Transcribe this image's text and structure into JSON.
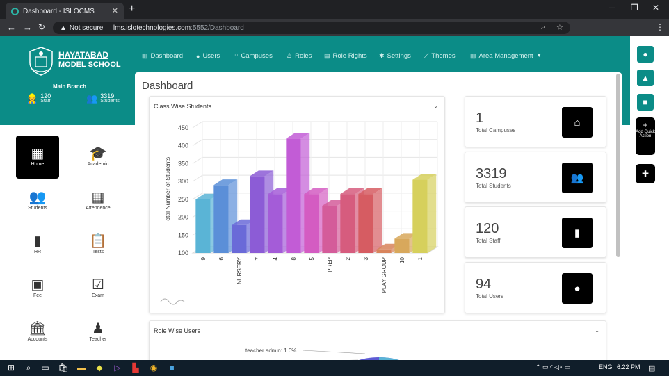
{
  "browser": {
    "tab_title": "Dashboard - ISLOCMS",
    "not_secure": "Not secure",
    "url_host": "lms.islotechnologies.com",
    "url_rest": ":5552/Dashboard"
  },
  "school": {
    "line1": "HAYATABAD",
    "line2": "MODEL SCHOOL"
  },
  "branch": "Main Branch",
  "header_stats": [
    {
      "value": "120",
      "label": "Staff"
    },
    {
      "value": "3319",
      "label": "Students"
    }
  ],
  "menu": [
    {
      "label": "Dashboard",
      "icon": "chart-icon"
    },
    {
      "label": "Users",
      "icon": "user-icon"
    },
    {
      "label": "Campuses",
      "icon": "sitemap-icon"
    },
    {
      "label": "Roles",
      "icon": "roles-icon"
    },
    {
      "label": "Role Rights",
      "icon": "list-icon"
    },
    {
      "label": "Settings",
      "icon": "gear-icon"
    },
    {
      "label": "Themes",
      "icon": "brush-icon"
    },
    {
      "label": "Area Management",
      "icon": "chart-icon"
    }
  ],
  "sidebar": [
    {
      "label": "Home",
      "icon": "home-grid-icon"
    },
    {
      "label": "Academic",
      "icon": "graduation-cap-icon"
    },
    {
      "label": "Students",
      "icon": "users-icon"
    },
    {
      "label": "Attendence",
      "icon": "calendar-icon"
    },
    {
      "label": "HR",
      "icon": "id-badge-icon"
    },
    {
      "label": "Tests",
      "icon": "clipboard-icon"
    },
    {
      "label": "Fee",
      "icon": "money-icon"
    },
    {
      "label": "Exam",
      "icon": "clipboard-check-icon"
    },
    {
      "label": "Accounts",
      "icon": "bank-icon"
    },
    {
      "label": "Teacher",
      "icon": "teacher-icon"
    }
  ],
  "page_title": "Dashboard",
  "chart_card_title": "Class Wise Students",
  "role_card_title": "Role Wise Users",
  "role_pie_label": "teacher admin: 1.0%",
  "quick_action": "Add Quick Action",
  "stat_cards": [
    {
      "value": "1",
      "label": "Total Campuses",
      "icon": "home-icon"
    },
    {
      "value": "3319",
      "label": "Total Students",
      "icon": "users-icon"
    },
    {
      "value": "120",
      "label": "Total Staff",
      "icon": "id-badge-icon"
    },
    {
      "value": "94",
      "label": "Total Users",
      "icon": "user-icon"
    }
  ],
  "taskbar": {
    "lang": "ENG",
    "time": "6:22 PM"
  },
  "chart_data": {
    "type": "bar",
    "ylabel": "Total Number of Students",
    "ylim": [
      100,
      450
    ],
    "yticks": [
      100,
      150,
      200,
      250,
      300,
      350,
      400,
      450
    ],
    "categories": [
      "9",
      "6",
      "NURSERY",
      "7",
      "4",
      "8",
      "5",
      "PREP",
      "2",
      "3",
      "PLAY GROUP",
      "10",
      "1"
    ],
    "values": [
      250,
      290,
      178,
      315,
      265,
      420,
      265,
      232,
      265,
      265,
      110,
      140,
      305
    ],
    "colors": [
      "#5ab4d6",
      "#5b8fd8",
      "#6a6ad8",
      "#8c5cd6",
      "#a45cd8",
      "#c25cd6",
      "#d45cc2",
      "#d45c9a",
      "#d65c7e",
      "#d65c62",
      "#d8845c",
      "#d8a85c",
      "#d6d05c"
    ]
  }
}
